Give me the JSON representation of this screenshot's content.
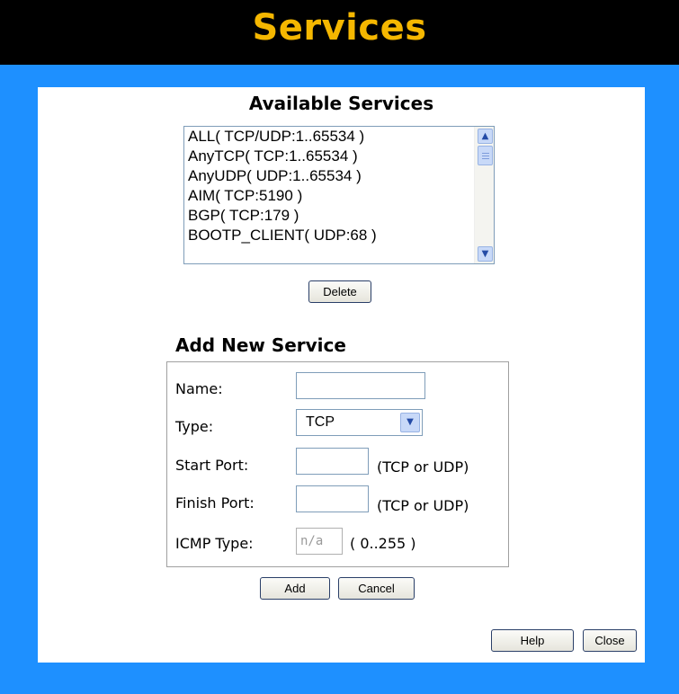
{
  "header": {
    "title": "Services"
  },
  "available": {
    "title": "Available Services",
    "items": [
      "ALL( TCP/UDP:1..65534 )",
      "AnyTCP( TCP:1..65534 )",
      "AnyUDP( UDP:1..65534 )",
      "AIM( TCP:5190 )",
      "BGP( TCP:179 )",
      "BOOTP_CLIENT( UDP:68 )"
    ],
    "delete_label": "Delete"
  },
  "add_service": {
    "title": "Add New Service",
    "name_label": "Name:",
    "name_value": "",
    "type_label": "Type:",
    "type_value": "TCP",
    "start_label": "Start Port:",
    "start_hint": "(TCP or UDP)",
    "finish_label": "Finish Port:",
    "finish_hint": "(TCP or UDP)",
    "icmp_label": "ICMP Type:",
    "icmp_placeholder": "n/a",
    "icmp_hint": "( 0..255 )",
    "add_label": "Add",
    "cancel_label": "Cancel"
  },
  "footer": {
    "help_label": "Help",
    "close_label": "Close"
  },
  "colors": {
    "background": "#1e90ff",
    "header_bg": "#000000",
    "title": "#f5b700"
  }
}
